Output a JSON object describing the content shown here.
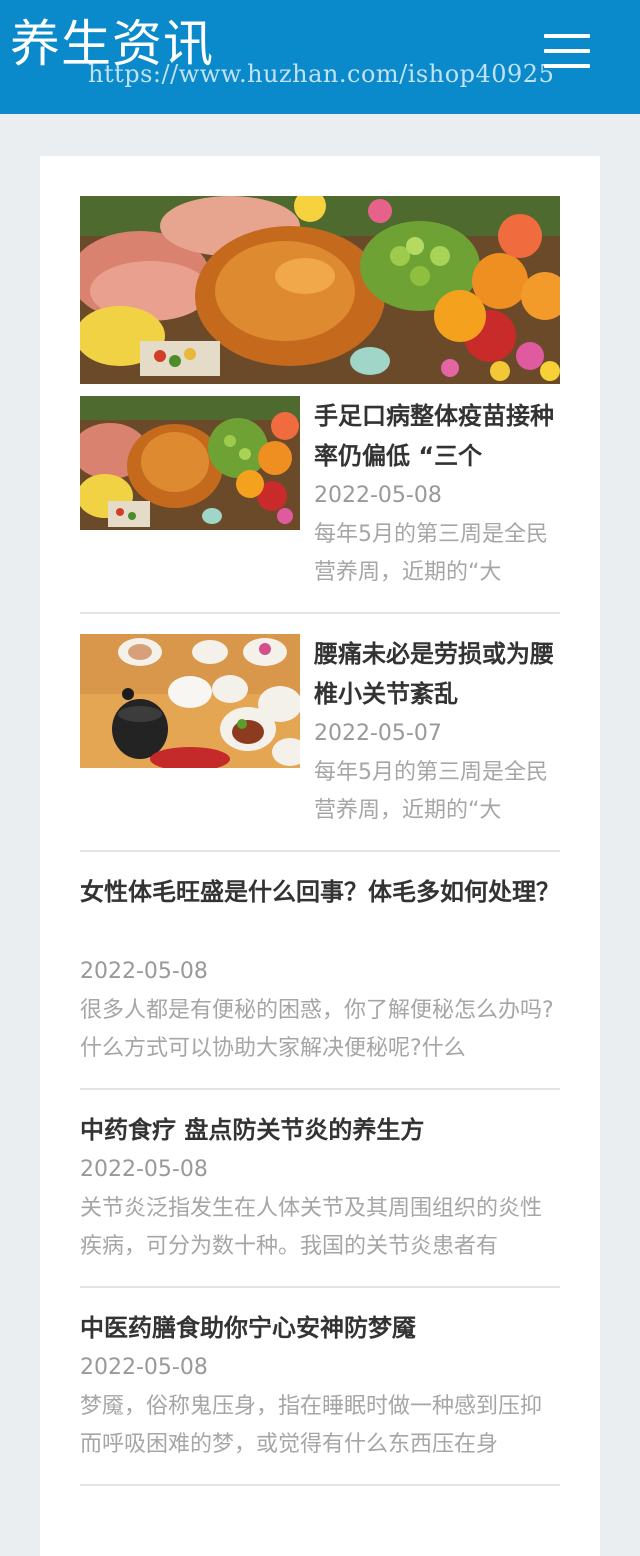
{
  "header": {
    "site_title": "养生资讯",
    "watermark": "https://www.huzhan.com/ishop40925",
    "menu_icon": "hamburger-menu-icon",
    "brand_color": "#0a8acb"
  },
  "articles": [
    {
      "title": "手足口病整体疫苗接种率仍偏低 “三个",
      "date": "2022-05-08",
      "summary": "每年5月的第三周是全民营养周，近期的“大"
    },
    {
      "title": "腰痛未必是劳损或为腰椎小关节紊乱",
      "date": "2022-05-07",
      "summary": "每年5月的第三周是全民营养周，近期的“大"
    },
    {
      "title": "女性体毛旺盛是什么回事？体毛多如何处理？",
      "date": "2022-05-08",
      "summary": "很多人都是有便秘的困惑，你了解便秘怎么办吗?什么方式可以协助大家解决便秘呢?什么"
    },
    {
      "title": "中药食疗 盘点防关节炎的养生方",
      "date": "2022-05-08",
      "summary": "关节炎泛指发生在人体关节及其周围组织的炎性疾病，可分为数十种。我国的关节炎患者有"
    },
    {
      "title": "中医药膳食助你宁心安神防梦魇",
      "date": "2022-05-08",
      "summary": "梦魇，俗称鬼压身，指在睡眠时做一种感到压抑而呼吸困难的梦，或觉得有什么东西压在身"
    }
  ]
}
